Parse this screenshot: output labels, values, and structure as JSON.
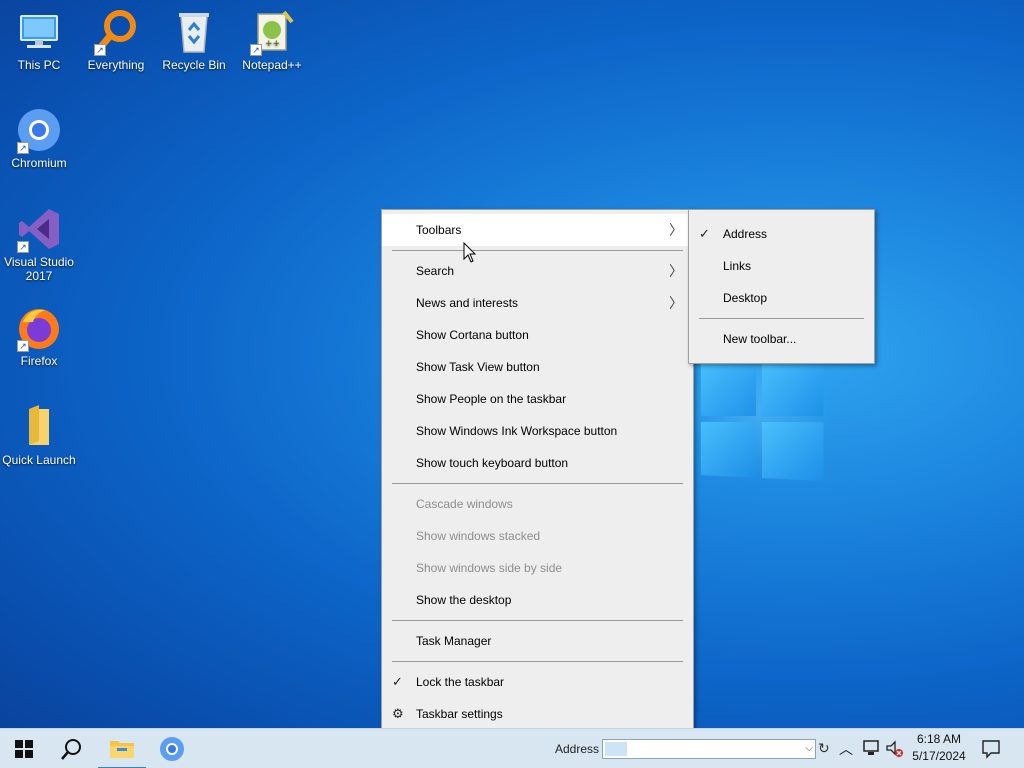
{
  "desktop": {
    "icons": [
      {
        "label": "This PC",
        "icon": "computer-icon"
      },
      {
        "label": "Everything",
        "icon": "magnifier-icon"
      },
      {
        "label": "Recycle Bin",
        "icon": "recycle-bin-icon"
      },
      {
        "label": "Notepad++",
        "icon": "notepad-plus-plus-icon"
      },
      {
        "label": "Chromium",
        "icon": "chromium-icon"
      },
      {
        "label": "Visual Studio 2017",
        "icon": "visual-studio-icon"
      },
      {
        "label": "Firefox",
        "icon": "firefox-icon"
      },
      {
        "label": "Quick Launch",
        "icon": "folder-icon"
      }
    ]
  },
  "context_menu": {
    "items": [
      {
        "label": "Toolbars",
        "submenu": true,
        "hover": true
      },
      {
        "label": "Search",
        "submenu": true
      },
      {
        "label": "News and interests",
        "submenu": true
      },
      {
        "label": "Show Cortana button"
      },
      {
        "label": "Show Task View button"
      },
      {
        "label": "Show People on the taskbar"
      },
      {
        "label": "Show Windows Ink Workspace button"
      },
      {
        "label": "Show touch keyboard button"
      },
      {
        "label": "Cascade windows",
        "disabled": true
      },
      {
        "label": "Show windows stacked",
        "disabled": true
      },
      {
        "label": "Show windows side by side",
        "disabled": true
      },
      {
        "label": "Show the desktop"
      },
      {
        "label": "Task Manager"
      },
      {
        "label": "Lock the taskbar",
        "checked": true
      },
      {
        "label": "Taskbar settings",
        "icon": "gear-icon"
      }
    ]
  },
  "toolbars_submenu": {
    "items": [
      {
        "label": "Address",
        "checked": true
      },
      {
        "label": "Links"
      },
      {
        "label": "Desktop"
      },
      {
        "label": "New toolbar..."
      }
    ]
  },
  "taskbar": {
    "address_label": "Address",
    "address_value": "",
    "clock_time": "6:18 AM",
    "clock_date": "5/17/2024"
  },
  "colors": {
    "menu_bg": "#eeeeee",
    "taskbar_bg": "#d8e6f2",
    "disabled_text": "#8e8e8e"
  }
}
